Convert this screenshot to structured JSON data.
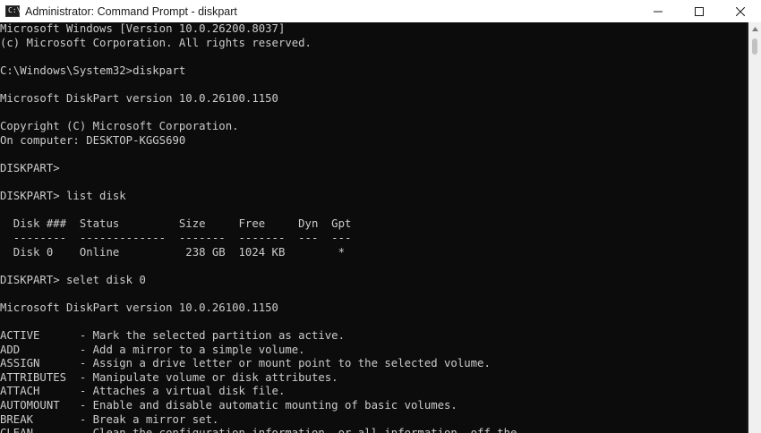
{
  "window": {
    "title": "Administrator: Command Prompt - diskpart",
    "icon_glyph": "C:\\",
    "controls": [
      "minimize-icon",
      "maximize-icon",
      "close-icon"
    ]
  },
  "console": {
    "lines": [
      "Microsoft Windows [Version 10.0.26200.8037]",
      "(c) Microsoft Corporation. All rights reserved.",
      "",
      "C:\\Windows\\System32>diskpart",
      "",
      "Microsoft DiskPart version 10.0.26100.1150",
      "",
      "Copyright (C) Microsoft Corporation.",
      "On computer: DESKTOP-KGGS690",
      "",
      "DISKPART>",
      "",
      "DISKPART> list disk",
      "",
      "  Disk ###  Status         Size     Free     Dyn  Gpt",
      "  --------  -------------  -------  -------  ---  ---",
      "  Disk 0    Online          238 GB  1024 KB        *",
      "",
      "DISKPART> selet disk 0",
      "",
      "Microsoft DiskPart version 10.0.26100.1150",
      "",
      "ACTIVE      - Mark the selected partition as active.",
      "ADD         - Add a mirror to a simple volume.",
      "ASSIGN      - Assign a drive letter or mount point to the selected volume.",
      "ATTRIBUTES  - Manipulate volume or disk attributes.",
      "ATTACH      - Attaches a virtual disk file.",
      "AUTOMOUNT   - Enable and disable automatic mounting of basic volumes.",
      "BREAK       - Break a mirror set.",
      "CLEAN       - Clean the configuration information, or all information, off the"
    ]
  },
  "colors": {
    "console_bg": "#0c0c0c",
    "console_text": "#cccccc",
    "titlebar_bg": "#ffffff"
  }
}
